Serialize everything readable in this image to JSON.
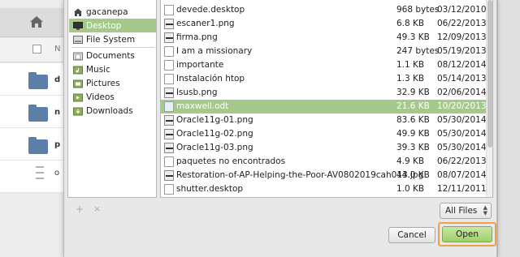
{
  "background_window": {
    "row_letters": [
      "d",
      "n",
      "p",
      "o"
    ]
  },
  "sidebar": {
    "items": [
      {
        "label": "gacanepa",
        "icon": "home-icon"
      },
      {
        "label": "Desktop",
        "icon": "desktop-icon",
        "selected": true
      },
      {
        "label": "File System",
        "icon": "harddisk-icon"
      },
      {
        "label": "Documents",
        "icon": "folder-icon"
      },
      {
        "label": "Music",
        "icon": "music-folder-icon"
      },
      {
        "label": "Pictures",
        "icon": "pictures-folder-icon"
      },
      {
        "label": "Videos",
        "icon": "videos-folder-icon"
      },
      {
        "label": "Downloads",
        "icon": "downloads-folder-icon"
      }
    ],
    "add_symbol": "+",
    "remove_symbol": "×"
  },
  "files": [
    {
      "name": "devede.desktop",
      "size": "968 bytes",
      "date": "03/12/2010",
      "icon": "desktop-file-icon"
    },
    {
      "name": "escaner1.png",
      "size": "6.8 KB",
      "date": "06/22/2013",
      "icon": "image-icon"
    },
    {
      "name": "firma.png",
      "size": "49.3 KB",
      "date": "12/09/2013",
      "icon": "image-icon"
    },
    {
      "name": "I am a missionary",
      "size": "247 bytes",
      "date": "05/19/2013",
      "icon": "text-file-icon"
    },
    {
      "name": "importante",
      "size": "1.1 KB",
      "date": "08/12/2014",
      "icon": "text-file-icon"
    },
    {
      "name": "Instalación htop",
      "size": "1.3 KB",
      "date": "05/14/2013",
      "icon": "text-file-icon"
    },
    {
      "name": "lsusb.png",
      "size": "32.9 KB",
      "date": "02/06/2014",
      "icon": "image-icon"
    },
    {
      "name": "maxwell.odt",
      "size": "21.6 KB",
      "date": "10/20/2013",
      "icon": "document-icon",
      "selected": true
    },
    {
      "name": "Oracle11g-01.png",
      "size": "83.6 KB",
      "date": "05/30/2014",
      "icon": "image-icon"
    },
    {
      "name": "Oracle11g-02.png",
      "size": "49.9 KB",
      "date": "05/30/2014",
      "icon": "image-icon"
    },
    {
      "name": "Oracle11g-03.png",
      "size": "39.3 KB",
      "date": "05/30/2014",
      "icon": "image-icon"
    },
    {
      "name": "paquetes no encontrados",
      "size": "4.9 KB",
      "date": "06/22/2013",
      "icon": "text-file-icon"
    },
    {
      "name": "Restoration-of-AP-Helping-the-Poor-AV0802019cah013.jpg",
      "size": "44.0 KB",
      "date": "08/07/2014",
      "icon": "image-icon"
    },
    {
      "name": "shutter.desktop",
      "size": "1.0 KB",
      "date": "12/11/2011",
      "icon": "desktop-file-icon"
    }
  ],
  "filter": {
    "label": "All Files"
  },
  "buttons": {
    "cancel": "Cancel",
    "open": "Open"
  },
  "colors": {
    "selection": "#a5c98b",
    "open_button": "#9fcf6c",
    "focus_ring": "#f0a04b"
  }
}
